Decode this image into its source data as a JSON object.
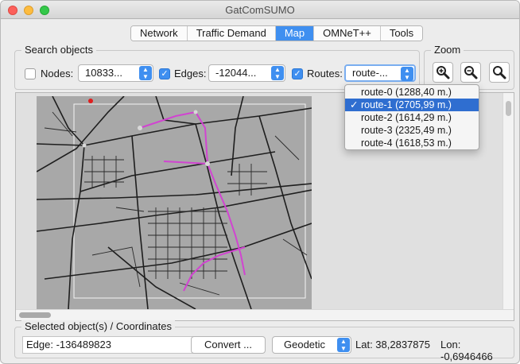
{
  "window": {
    "title": "GatComSUMO"
  },
  "tabs": [
    {
      "label": "Network",
      "active": false
    },
    {
      "label": "Traffic Demand",
      "active": false
    },
    {
      "label": "Map",
      "active": true
    },
    {
      "label": "OMNeT++",
      "active": false
    },
    {
      "label": "Tools",
      "active": false
    }
  ],
  "search": {
    "title": "Search objects",
    "nodes": {
      "label": "Nodes:",
      "checked": false,
      "value": "10833..."
    },
    "edges": {
      "label": "Edges:",
      "checked": true,
      "value": "-12044..."
    },
    "routes": {
      "label": "Routes:",
      "checked": true,
      "value": "route-..."
    }
  },
  "zoom": {
    "title": "Zoom",
    "buttons": [
      "zoom-in-icon",
      "zoom-out-icon",
      "zoom-reset-icon"
    ]
  },
  "routes_dropdown": {
    "options": [
      "route-0 (1288,40 m.)",
      "route-1 (2705,99 m.)",
      "route-2 (1614,29 m.)",
      "route-3 (2325,49 m.)",
      "route-4 (1618,53 m.)"
    ],
    "selected_index": 1
  },
  "selected": {
    "title": "Selected object(s) / Coordinates",
    "edge_text": "Edge: -136489823",
    "convert_label": "Convert ...",
    "coord_system": "Geodetic",
    "lat": "Lat: 38,2837875",
    "lon": "Lon: -0,6946466"
  },
  "colors": {
    "accent": "#3f8ff0",
    "route": "#cc33cc",
    "map_bg": "#a8a8a8",
    "selection": "#2f6ed0"
  }
}
